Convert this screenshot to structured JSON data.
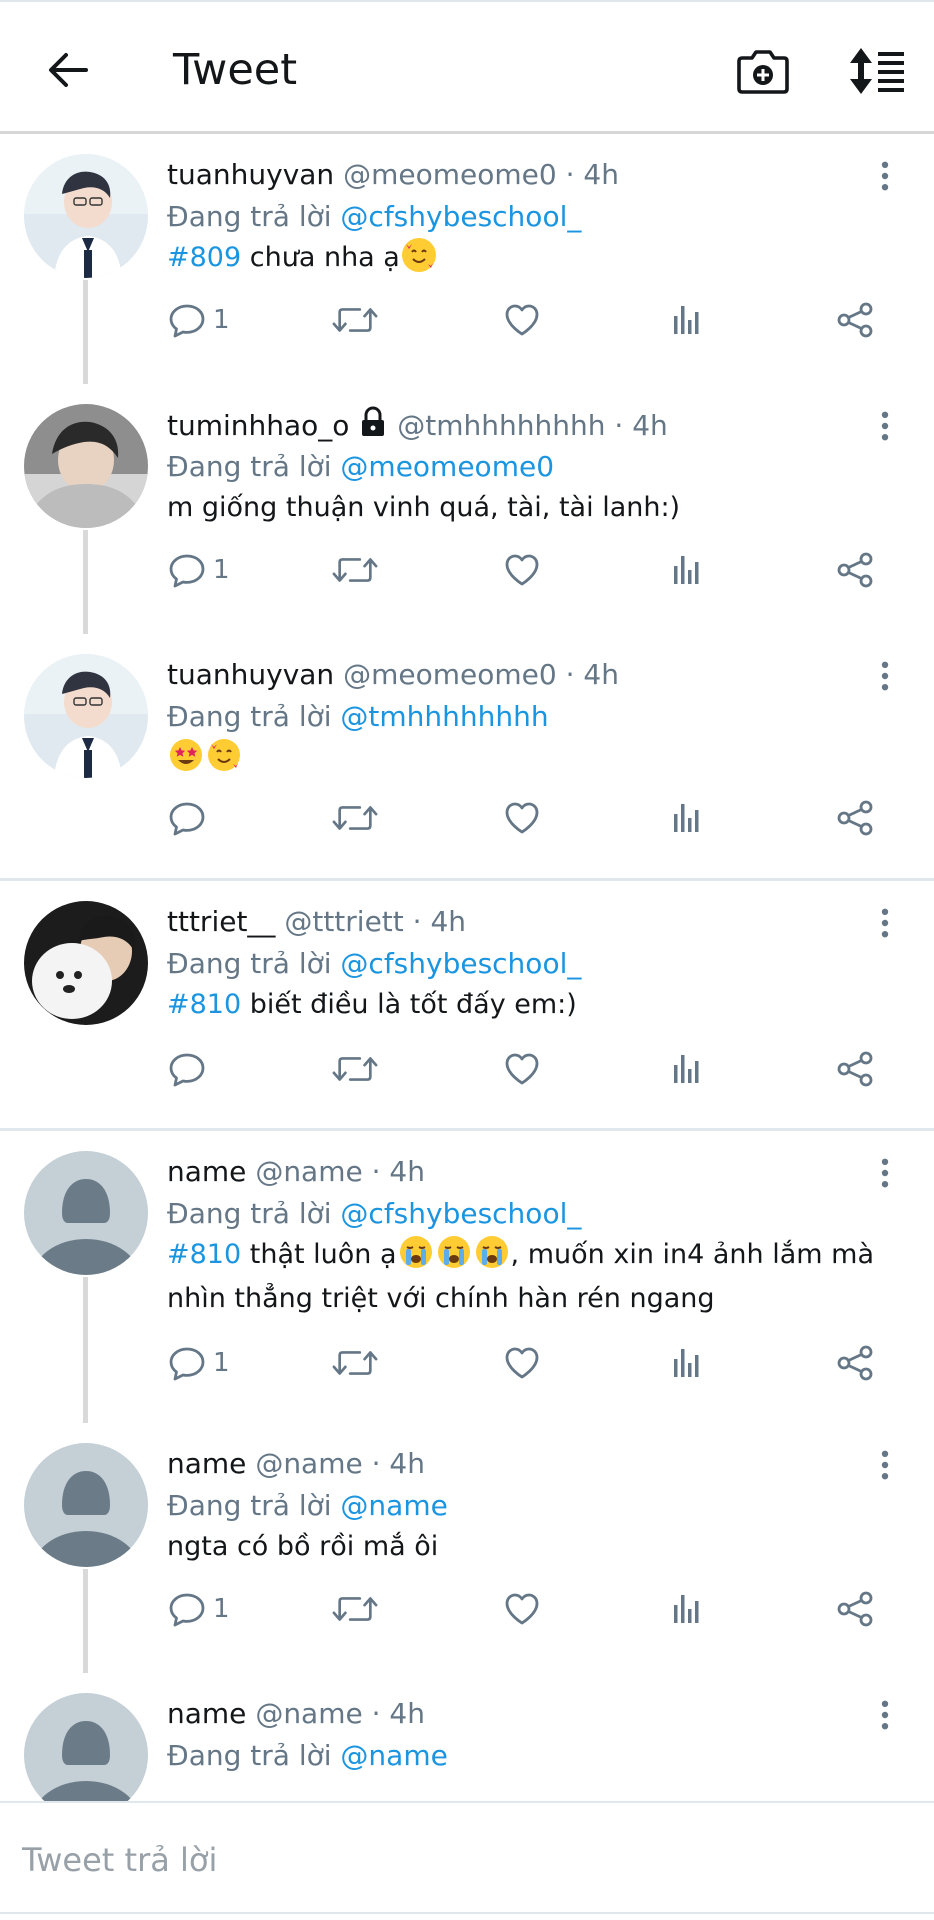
{
  "header": {
    "title": "Tweet",
    "back_icon": "arrow-left-icon",
    "camera_icon": "camera-plus-icon",
    "sort_icon": "sort-icon"
  },
  "colors": {
    "accent": "#1b95e0",
    "muted": "#657786",
    "icon": "#657786",
    "divider": "#e1e8ed"
  },
  "tweets": [
    {
      "name": "tuanhuyvan",
      "handle": "@meomeome0",
      "time": "· 4h",
      "replying_prefix": "Đang trả lời",
      "replying_to": "@cfshybeschool_",
      "tag": "#809",
      "text": " chưa nha ạ",
      "emojis": [
        "smiling-face-with-hearts"
      ],
      "reply_count": "1"
    },
    {
      "name": "tuminhhao_o",
      "locked": true,
      "handle": "@tmhhhhhhhh",
      "time": "· 4h",
      "replying_prefix": "Đang trả lời",
      "replying_to": "@meomeome0",
      "text": "m giống thuận vinh quá, tài, tài lanh:)",
      "reply_count": "1"
    },
    {
      "name": "tuanhuyvan",
      "handle": "@meomeome0",
      "time": "· 4h",
      "replying_prefix": "Đang trả lời",
      "replying_to": "@tmhhhhhhhh",
      "emojis": [
        "star-struck",
        "smiling-face-with-hearts"
      ],
      "reply_count": ""
    },
    {
      "name": "tttriet__",
      "handle": "@tttriett",
      "time": "· 4h",
      "replying_prefix": "Đang trả lời",
      "replying_to": "@cfshybeschool_",
      "tag": "#810",
      "text": " biết điều là tốt đấy em:)",
      "reply_count": ""
    },
    {
      "name": "name",
      "handle": "@name",
      "time": "· 4h",
      "replying_prefix": "Đang trả lời",
      "replying_to": "@cfshybeschool_",
      "tag": "#810",
      "text_a": " thật luôn ạ",
      "text_b": ", muốn xin in4 ảnh lắm mà nhìn thẳng triệt với chính hàn rén ngang",
      "emojis": [
        "loudly-crying",
        "loudly-crying",
        "loudly-crying"
      ],
      "reply_count": "1"
    },
    {
      "name": "name",
      "handle": "@name",
      "time": "· 4h",
      "replying_prefix": "Đang trả lời",
      "replying_to": "@name",
      "text": "ngta có bồ rồi mắ ôi",
      "reply_count": "1"
    },
    {
      "name": "name",
      "handle": "@name",
      "time": "· 4h",
      "replying_prefix": "Đang trả lời",
      "replying_to": "@name"
    }
  ],
  "composer": {
    "placeholder": "Tweet trả lời"
  }
}
